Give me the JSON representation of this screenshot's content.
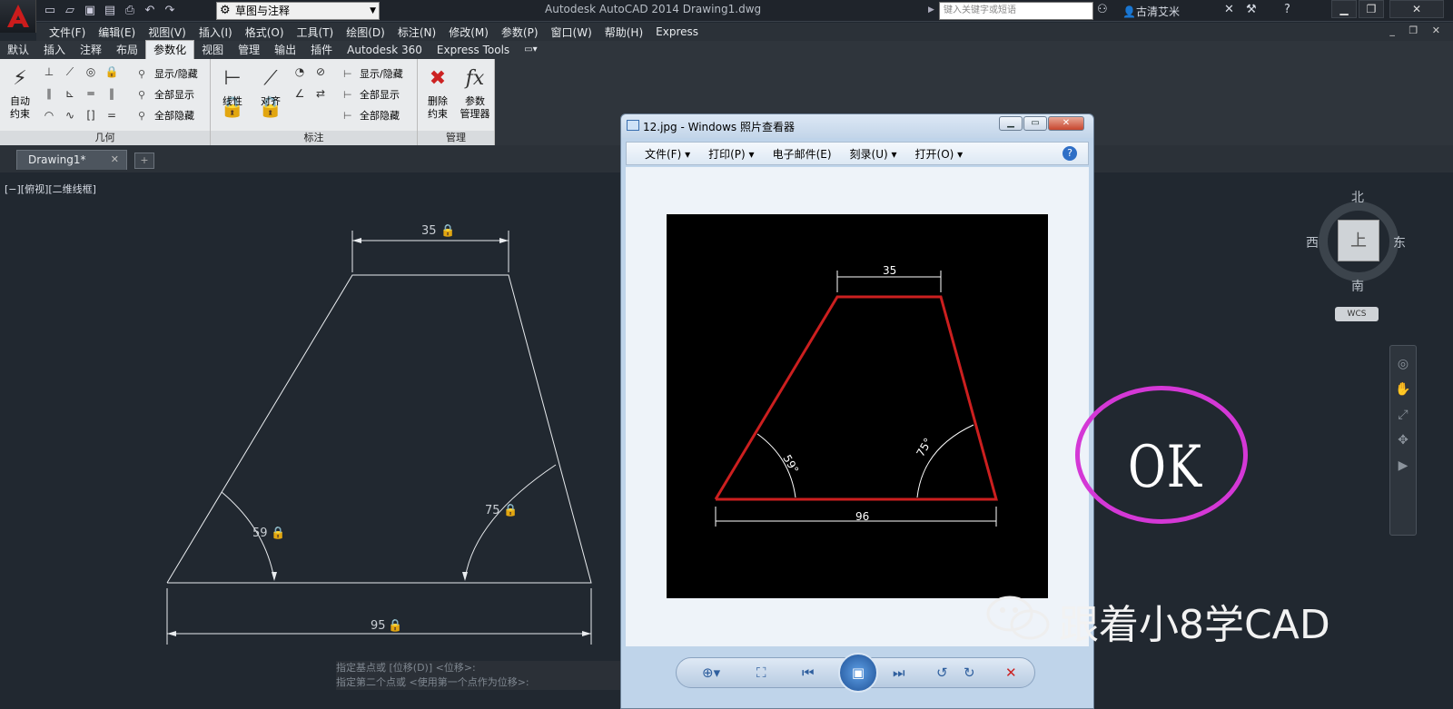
{
  "title_bar": {
    "workspace": "草图与注释",
    "app_title": "Autodesk AutoCAD 2014    Drawing1.dwg",
    "search_placeholder": "键入关键字或短语",
    "user": "古清艾米"
  },
  "menu_bar": [
    "文件(F)",
    "编辑(E)",
    "视图(V)",
    "插入(I)",
    "格式(O)",
    "工具(T)",
    "绘图(D)",
    "标注(N)",
    "修改(M)",
    "参数(P)",
    "窗口(W)",
    "帮助(H)",
    "Express"
  ],
  "ribbon_tabs": [
    "默认",
    "插入",
    "注释",
    "布局",
    "参数化",
    "视图",
    "管理",
    "输出",
    "插件",
    "Autodesk 360",
    "Express Tools"
  ],
  "ribbon_active_tab": "参数化",
  "ribbon": {
    "geometry": {
      "auto_constrain": "自动\n约束",
      "show_hide": "显示/隐藏",
      "show_all": "全部显示",
      "hide_all": "全部隐藏",
      "label": "几何"
    },
    "dimensional": {
      "linear": "线性",
      "aligned": "对齐",
      "show_hide": "显示/隐藏",
      "show_all": "全部显示",
      "hide_all": "全部隐藏",
      "label": "标注"
    },
    "manage": {
      "delete_constraints": "删除\n约束",
      "param_manager": "参数\n管理器",
      "label": "管理"
    }
  },
  "doc_tab": "Drawing1*",
  "viewport_label": "[−][俯视][二维线框]",
  "drawing": {
    "top_dim": "35",
    "bottom_dim": "95",
    "left_angle": "59",
    "right_angle": "75"
  },
  "command_lines": [
    "指定基点或 [位移(D)] <位移>:",
    "指定第二个点或 <使用第一个点作为位移>:"
  ],
  "viewcube": {
    "north": "北",
    "south": "南",
    "east": "东",
    "west": "西",
    "top": "上",
    "wcs": "WCS"
  },
  "photo_viewer": {
    "title": "12.jpg - Windows 照片查看器",
    "menu": [
      "文件(F)",
      "打印(P)",
      "电子邮件(E)",
      "刻录(U)",
      "打开(O)"
    ],
    "image": {
      "top_dim": "35",
      "bottom_dim": "96",
      "left_angle": "59°",
      "right_angle": "75°",
      "line_color": "#cc1f1f"
    }
  },
  "annotation": {
    "text": "OK",
    "circle_color": "#d438d6"
  },
  "watermark": "跟着小8学CAD"
}
